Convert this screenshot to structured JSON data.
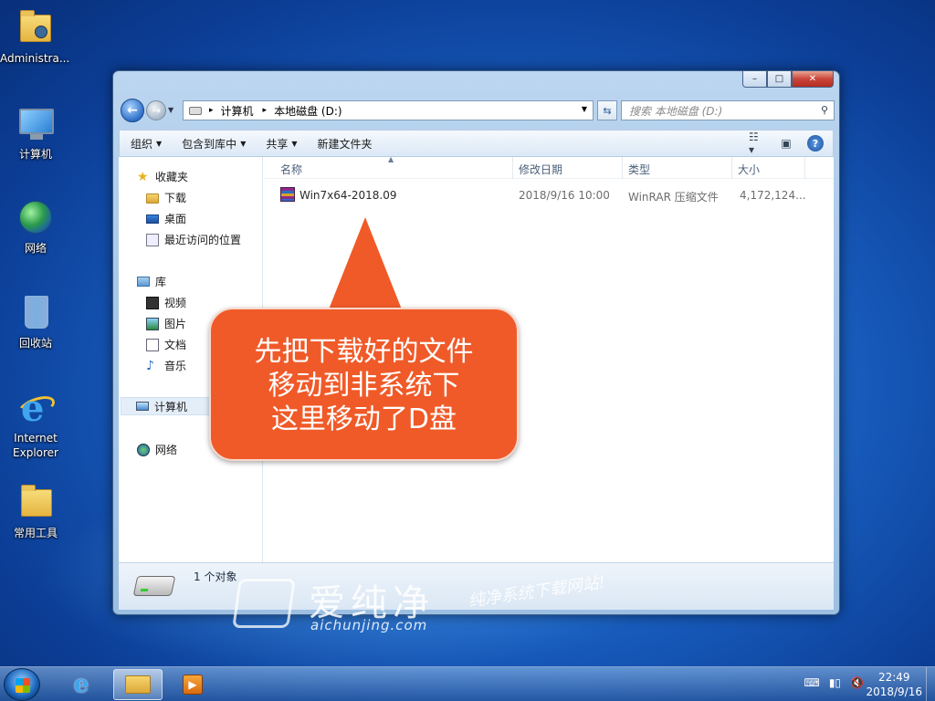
{
  "desktop": {
    "icons": [
      {
        "label": "Administra..."
      },
      {
        "label": "计算机"
      },
      {
        "label": "网络"
      },
      {
        "label": "回收站"
      },
      {
        "label": "Internet Explorer"
      },
      {
        "label": "常用工具"
      }
    ]
  },
  "window": {
    "controls": {
      "minimize": "–",
      "maximize": "□",
      "close": "✕"
    },
    "address": {
      "crumbs": [
        "计算机",
        "本地磁盘 (D:)"
      ],
      "separator": "▸"
    },
    "search": {
      "placeholder": "搜索 本地磁盘 (D:)"
    },
    "toolbar": {
      "organize": "组织",
      "include_library": "包含到库中",
      "share": "共享",
      "new_folder": "新建文件夹"
    },
    "nav": {
      "favorites": "收藏夹",
      "downloads": "下载",
      "desktop": "桌面",
      "recent": "最近访问的位置",
      "libraries": "库",
      "videos": "视频",
      "pictures": "图片",
      "documents": "文档",
      "music": "音乐",
      "computer": "计算机",
      "network": "网络"
    },
    "columns": {
      "name": "名称",
      "modified": "修改日期",
      "type": "类型",
      "size": "大小"
    },
    "files": [
      {
        "name": "Win7x64-2018.09",
        "modified": "2018/9/16 10:00",
        "type": "WinRAR 压缩文件",
        "size": "4,172,124..."
      }
    ],
    "details": {
      "count": "1 个对象"
    }
  },
  "callout": {
    "lines": [
      "先把下载好的文件",
      "移动到非系统下",
      "这里移动了D盘"
    ],
    "color": "#f05a28"
  },
  "watermark": {
    "brand_cn": "爱纯净",
    "brand_en": "aichunjing.com",
    "slogan": "纯净系统下载网站!"
  },
  "taskbar": {
    "tray": {
      "keyboard": "⌨",
      "network": "▮▯",
      "volume": "🔇"
    },
    "clock": {
      "time": "22:49",
      "date": "2018/9/16"
    }
  }
}
